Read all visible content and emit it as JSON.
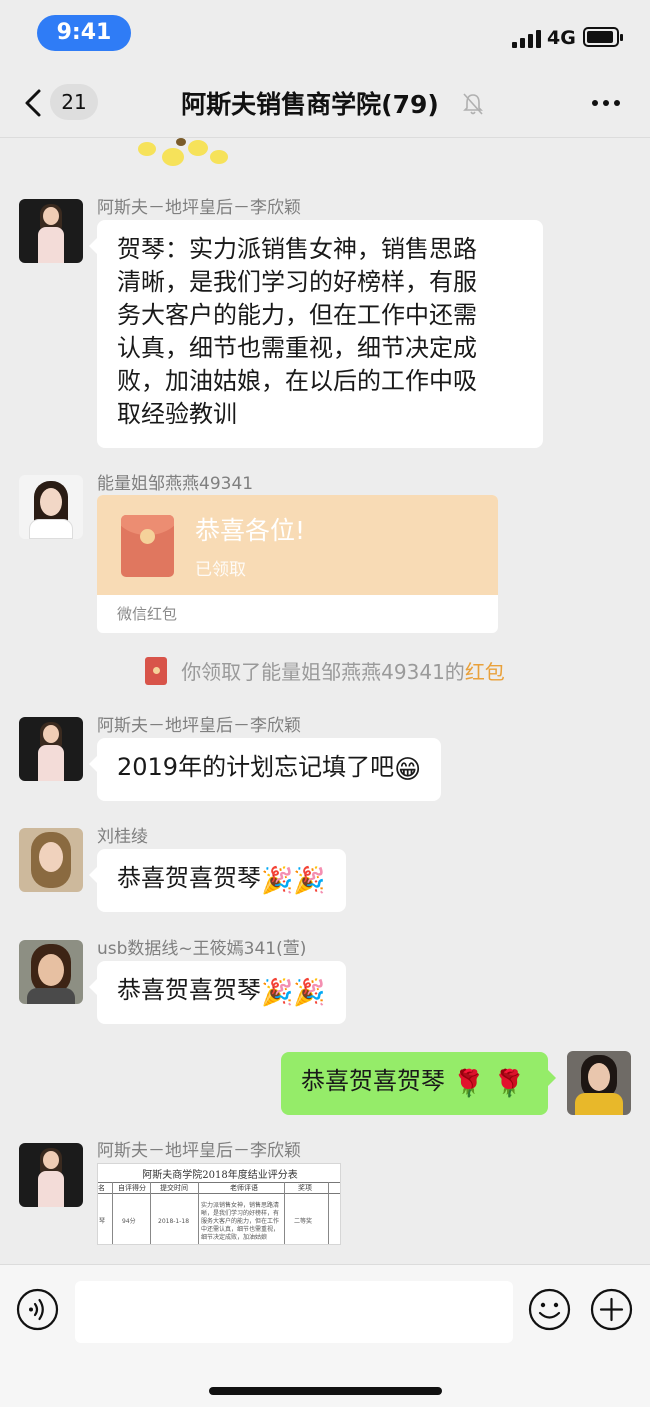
{
  "status_bar": {
    "time": "9:41",
    "network": "4G",
    "icons": [
      "signal-icon",
      "battery-icon"
    ]
  },
  "nav": {
    "unread_count": "21",
    "title": "阿斯夫销售商学院(79)",
    "icons": [
      "back-icon",
      "mute-icon",
      "more-icon"
    ]
  },
  "messages": [
    {
      "sender": "阿斯夫－地坪皇后－李欣颖",
      "lines": [
        "贺琴：实力派销售女神，销售思路",
        "清晰，是我们学习的好榜样，有服",
        "务大客户的能力，但在工作中还需",
        "认真，细节也需重视，细节决定成",
        "败，加油姑娘，在以后的工作中吸",
        "取经验教训"
      ]
    },
    {
      "sender": "能量姐邹燕燕49341",
      "red_packet": {
        "title": "恭喜各位!",
        "status": "已领取",
        "footer": "微信红包"
      }
    },
    {
      "system": {
        "text": "你领取了能量姐邹燕燕49341的",
        "highlight": "红包"
      }
    },
    {
      "sender": "阿斯夫－地坪皇后－李欣颖",
      "text": "2019年的计划忘记填了吧",
      "emoji": "😁"
    },
    {
      "sender": "刘桂绫",
      "text": "恭喜贺喜贺琴",
      "emoji": "🎉🎉"
    },
    {
      "sender": "usb数据线~王筱嫣341(萱)",
      "text": "恭喜贺喜贺琴",
      "emoji": "🎉🎉"
    },
    {
      "self": true,
      "text": "恭喜贺喜贺琴",
      "emoji": "🌹 🌹"
    },
    {
      "sender": "阿斯夫－地坪皇后－李欣颖",
      "image": {
        "title": "阿斯夫商学院2018年度结业评分表",
        "headers": [
          "名",
          "自评得分",
          "提交时间",
          "老师评语",
          "奖项"
        ],
        "row": [
          "琴",
          "94分",
          "2018-1-18",
          "实力派销售女神，销售思路清晰，是我们学习的好榜样，有服务大客户的能力，但在工作中还需认真，细节也需重视，细节决定成败，加油姑娘",
          "二等奖"
        ]
      }
    }
  ],
  "input_bar": {
    "icons": [
      "voice-icon",
      "emoji-icon",
      "plus-icon"
    ]
  }
}
